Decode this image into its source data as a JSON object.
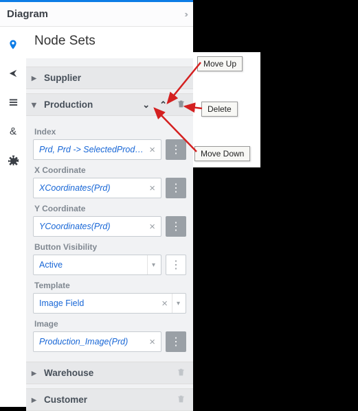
{
  "panel": {
    "title": "Diagram"
  },
  "section": {
    "title": "Node Sets"
  },
  "accordions": {
    "supplier": {
      "label": "Supplier"
    },
    "production": {
      "label": "Production"
    },
    "warehouse": {
      "label": "Warehouse"
    },
    "customer": {
      "label": "Customer"
    }
  },
  "fields": {
    "index": {
      "label": "Index",
      "value": "Prd, Prd -> SelectedProducti"
    },
    "xcoord": {
      "label": "X Coordinate",
      "value": "XCoordinates(Prd)"
    },
    "ycoord": {
      "label": "Y Coordinate",
      "value": "YCoordinates(Prd)"
    },
    "btnvis": {
      "label": "Button Visibility",
      "value": "Active"
    },
    "template": {
      "label": "Template",
      "value": "Image Field"
    },
    "image": {
      "label": "Image",
      "value": "Production_Image(Prd)"
    }
  },
  "callouts": {
    "moveup": "Move Up",
    "delete": "Delete",
    "movedown": "Move Down"
  }
}
